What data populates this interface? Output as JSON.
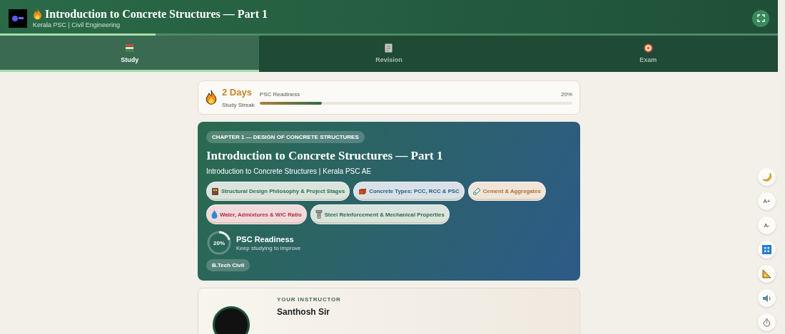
{
  "header": {
    "title": "Introduction to Concrete Structures — Part 1",
    "subtitle": "Kerala PSC | Civil Engineering",
    "progress": {
      "level": 0.2
    }
  },
  "tabs": [
    {
      "label": "Study",
      "selected": true,
      "kind": "books"
    },
    {
      "label": "Revision",
      "selected": false,
      "kind": "memo"
    },
    {
      "label": "Exam",
      "selected": false,
      "kind": "target"
    }
  ],
  "streak": {
    "value": "2 Days",
    "label": "Study Streak",
    "readiness_label": "PSC Readiness",
    "readiness_value": "20%",
    "level": 0.2
  },
  "hero": {
    "chapter": "CHAPTER 1 — DESIGN OF CONCRETE STRUCTURES",
    "title": "Introduction to Concrete Structures — Part 1",
    "subtitle": "Introduction to Concrete Structures | Kerala PSC AE",
    "topics": [
      {
        "label": "Structural Design Philosophy & Project Stages",
        "kind": "building",
        "color": "#2f6b45"
      },
      {
        "label": "Concrete Types: PCC, RCC & PSC",
        "kind": "brick",
        "color": "#2c5a80"
      },
      {
        "label": "Cement & Aggregates",
        "kind": "tube",
        "color": "#b07030"
      },
      {
        "label": "Water, Admixtures & W/C Ratio",
        "kind": "drop",
        "color": "#b0303f"
      },
      {
        "label": "Steel Reinforcement & Mechanical Properties",
        "kind": "bolt",
        "color": "#2f6b45"
      }
    ],
    "readiness": {
      "value": "20%",
      "title": "PSC Readiness",
      "note": "Keep studying to improve",
      "level": 0.2
    },
    "tag": "B.Tech Civil"
  },
  "instructor": {
    "label": "YOUR INSTRUCTOR",
    "name": "Santhosh Sir"
  },
  "side_tools": [
    {
      "kind": "moon"
    },
    {
      "kind": "text",
      "label": "A+"
    },
    {
      "kind": "text",
      "label": "A-"
    },
    {
      "kind": "grid"
    },
    {
      "kind": "ruler"
    },
    {
      "kind": "speaker"
    },
    {
      "kind": "timer"
    }
  ]
}
